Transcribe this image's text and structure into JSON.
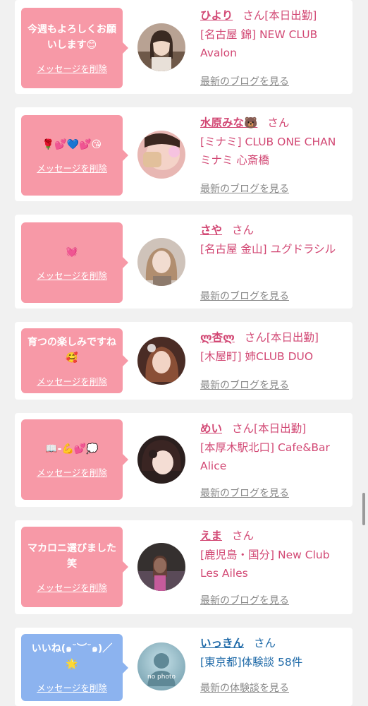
{
  "cards": [
    {
      "message": "今週もよろしくお願いします😊",
      "delete": "メッセージを削除",
      "name": "ひより",
      "honorific": "さん",
      "status": "[本日出勤]",
      "shop": "[名古屋 錦] NEW CLUB Avalon",
      "blog": "最新のブログを見る"
    },
    {
      "message": "🌹💕💙💕😘",
      "delete": "メッセージを削除",
      "name": "水原みな🐻",
      "honorific": "さん",
      "status": "",
      "shop": "[ミナミ] CLUB ONE CHAN ミナミ 心斎橋",
      "blog": "最新のブログを見る"
    },
    {
      "message": "💓",
      "delete": "メッセージを削除",
      "name": "さや",
      "honorific": "さん",
      "status": "",
      "shop": "[名古屋 金山] ユグドラシル",
      "blog": "最新のブログを見る"
    },
    {
      "message": "育つの楽しみですね🥰",
      "delete": "メッセージを削除",
      "name": "ლ杏ლ",
      "honorific": "さん",
      "status": "[本日出勤]",
      "shop": "[木屋町] 姉CLUB DUO",
      "blog": "最新のブログを見る"
    },
    {
      "message": "📖-💪💕💭",
      "delete": "メッセージを削除",
      "name": "めい",
      "honorific": "さん",
      "status": "[本日出勤]",
      "shop": "[本厚木駅北口] Cafe&Bar Alice",
      "blog": "最新のブログを見る"
    },
    {
      "message": "マカロニ選びました笑",
      "delete": "メッセージを削除",
      "name": "えま",
      "honorific": "さん",
      "status": "",
      "shop": "[鹿児島・国分] New Club Les Ailes",
      "blog": "最新のブログを見る"
    },
    {
      "message": "いいね(๑˘︶˘๑)／🌟",
      "delete": "メッセージを削除",
      "name": "いっきん",
      "honorific": "さん",
      "status": "",
      "shop": "[東京都]体験談 58件",
      "blog": "最新の体験談を見る",
      "avatar_text": "no photo"
    }
  ],
  "colors": {
    "pink": "#f799a7",
    "blue": "#8cb3ef",
    "name_pink": "#d24874",
    "name_blue": "#1f6aa8"
  }
}
